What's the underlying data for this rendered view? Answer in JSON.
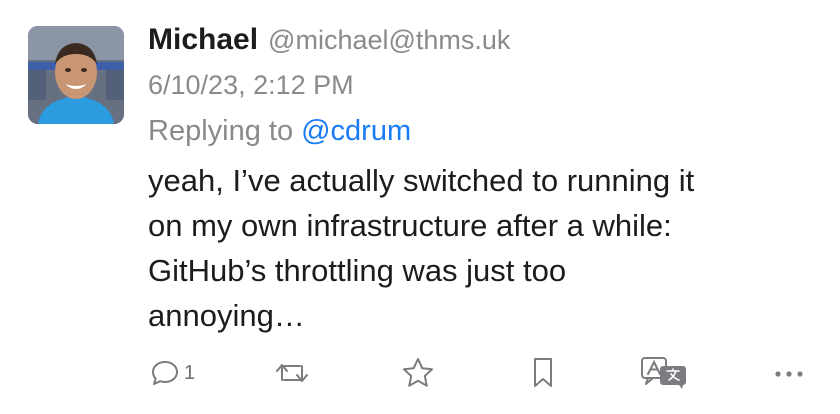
{
  "post": {
    "author": {
      "display_name": "Michael",
      "handle": "@michael@thms.uk"
    },
    "timestamp": "6/10/23, 2:12 PM",
    "reply_context": {
      "prefix": "Replying to",
      "mention": "@cdrum"
    },
    "body_lines": [
      "yeah, I’ve actually switched to running it",
      "on my own infrastructure after a while:",
      "GitHub’s throttling was just too",
      "annoying…"
    ],
    "actions": {
      "reply_count": "1"
    }
  },
  "colors": {
    "mention": "#1a7cf5",
    "secondary_text": "#8a8a8e",
    "icon": "#7c7c80"
  },
  "icons": [
    "reply-icon",
    "boost-icon",
    "favourite-icon",
    "bookmark-icon",
    "translate-icon",
    "more-icon"
  ]
}
